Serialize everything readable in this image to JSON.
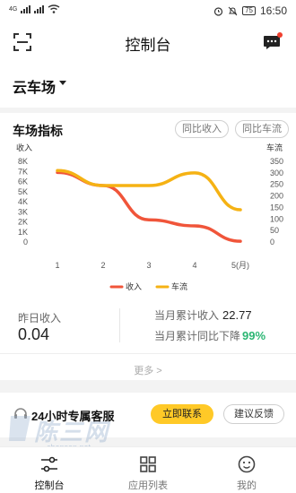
{
  "status_bar": {
    "signal_badge": "4G",
    "battery_level": "75",
    "time": "16:50"
  },
  "header": {
    "title": "控制台"
  },
  "lot": {
    "name": "云车场"
  },
  "metrics": {
    "title": "车场指标",
    "compare_mom": "同比收入",
    "compare_yoy": "同比车流",
    "yesterday_label": "昨日收入",
    "yesterday_value": "0.04",
    "month_income_label": "当月累计收入",
    "month_income_value": "22.77",
    "month_change_label": "当月累计同比下降",
    "month_change_value": "99%",
    "more_label": "更多 >"
  },
  "chart_data": {
    "type": "line",
    "x": [
      "1",
      "2",
      "3",
      "4",
      "5(月)"
    ],
    "left_axis": {
      "label": "收入",
      "ticks": [
        "8K",
        "7K",
        "6K",
        "5K",
        "4K",
        "3K",
        "2K",
        "1K",
        "0"
      ],
      "range": [
        0,
        8000
      ]
    },
    "right_axis": {
      "label": "车流",
      "ticks": [
        "350",
        "300",
        "250",
        "200",
        "150",
        "100",
        "50",
        "0"
      ],
      "range": [
        0,
        350
      ]
    },
    "series": [
      {
        "name": "收入",
        "axis": "left",
        "color": "#f0553a",
        "values": [
          6900,
          5600,
          2200,
          1600,
          80
        ]
      },
      {
        "name": "车流",
        "axis": "right",
        "color": "#f5b214",
        "values": [
          310,
          245,
          245,
          300,
          140
        ]
      }
    ]
  },
  "service": {
    "title": "24小时专属客服",
    "contact_label": "立即联系",
    "feedback_label": "建议反馈"
  },
  "tabs": [
    {
      "label": "控制台",
      "icon": "sliders-icon",
      "active": true
    },
    {
      "label": "应用列表",
      "icon": "grid-icon",
      "active": false
    },
    {
      "label": "我的",
      "icon": "smile-icon",
      "active": false
    }
  ],
  "watermark": {
    "text": "陈三网",
    "url": "chensan.net"
  },
  "colors": {
    "accent": "#ffc927",
    "income_line": "#f0553a",
    "traffic_line": "#f5b214",
    "positive": "#2bb673"
  }
}
